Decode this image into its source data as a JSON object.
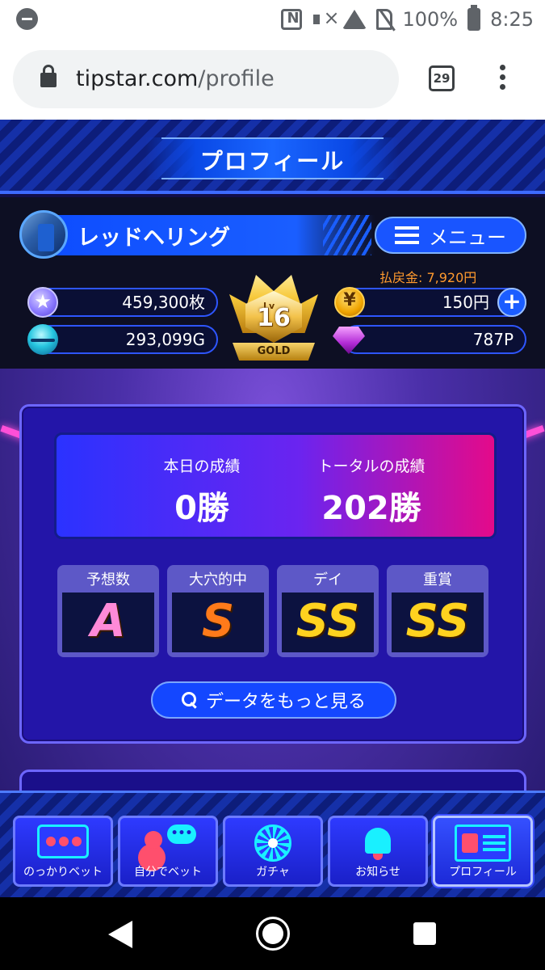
{
  "status_bar": {
    "battery": "100%",
    "time": "8:25"
  },
  "browser": {
    "url_domain": "tipstar.com",
    "url_path": "/profile",
    "tab_count": "29"
  },
  "header": {
    "title": "プロフィール"
  },
  "profile": {
    "username": "レッドヘリング",
    "menu_label": "メニュー",
    "refund_label": "払戻金: 7,920円",
    "coins": "459,300枚",
    "gold": "293,099G",
    "yen": "150円",
    "points": "787P",
    "level": "16",
    "level_prefix": "Lv",
    "rank": "GOLD"
  },
  "results": {
    "today_label": "本日の成績",
    "today_value": "0勝",
    "total_label": "トータルの成績",
    "total_value": "202勝"
  },
  "grades": [
    {
      "title": "予想数",
      "value": "A",
      "color": "#ff8ad8"
    },
    {
      "title": "大穴的中",
      "value": "S",
      "color": "#ff7a1a"
    },
    {
      "title": "デイ",
      "value": "SS",
      "color": "#ffd21f"
    },
    {
      "title": "重賞",
      "value": "SS",
      "color": "#ffd21f"
    }
  ],
  "more_button": "データをもっと見る",
  "bottom_nav": [
    {
      "label": "のっかりベット",
      "icon": "tv-icon"
    },
    {
      "label": "自分でベット",
      "icon": "chat-bet-icon"
    },
    {
      "label": "ガチャ",
      "icon": "gacha-wheel-icon"
    },
    {
      "label": "お知らせ",
      "icon": "bell-icon"
    },
    {
      "label": "プロフィール",
      "icon": "profile-card-icon",
      "active": true
    }
  ],
  "colors": {
    "accent": "#1955ff",
    "refund": "#ff9a2e",
    "score_gradient_end": "#e40a8a"
  }
}
